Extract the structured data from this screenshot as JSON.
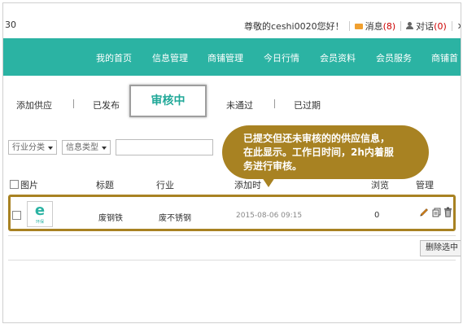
{
  "topbar": {
    "left_text": "30",
    "greeting": "尊敬的ceshi0020您好！",
    "messages_label": "消息",
    "messages_count": "(8)",
    "dialog_label": "对话",
    "dialog_count": "(0)",
    "logout_label": "退"
  },
  "nav": {
    "items": [
      "我的首页",
      "信息管理",
      "商铺管理",
      "今日行情",
      "会员资料",
      "会员服务",
      "商铺首"
    ]
  },
  "tabs": {
    "items": [
      "添加供应",
      "已发布",
      "审核中",
      "未通过",
      "已过期"
    ],
    "active": "审核中"
  },
  "filters": {
    "industry": "行业分类",
    "info_type": "信息类型"
  },
  "table": {
    "headers": [
      "图片",
      "标题",
      "行业",
      "添加时",
      "浏览",
      "管理"
    ],
    "rows": [
      {
        "thumb_letter": "e",
        "thumb_caption": "环保",
        "title": "废钢铁",
        "industry": "废不锈钢",
        "date": "2015-08-06 09:15",
        "views": "0"
      }
    ]
  },
  "delete_selected_label": "删除选中",
  "tooltip": {
    "lines": [
      "已提交但还未审核的的供应信息，",
      "在此显示。工作日时间，2h内着服",
      "务进行审核。"
    ]
  },
  "colors": {
    "nav_bg": "#2bb3a3",
    "highlight": "#a88222",
    "alert_red": "#cc0000"
  }
}
